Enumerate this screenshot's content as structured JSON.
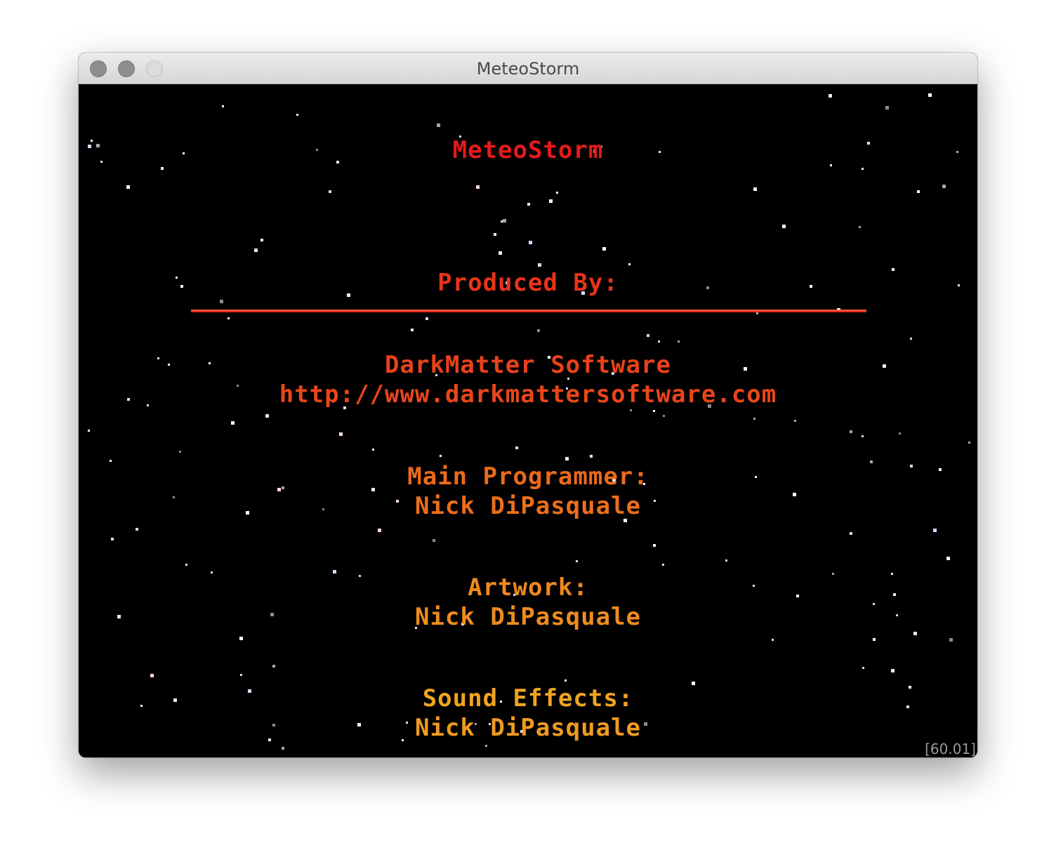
{
  "window": {
    "title": "MeteoStorm"
  },
  "credits": {
    "game_title": "MeteoStorm",
    "produced_by_label": "Produced By:",
    "producer_name": "DarkMatter Software",
    "producer_url": "http://www.darkmattersoftware.com",
    "main_programmer_label": "Main Programmer:",
    "main_programmer_name": "Nick DiPasquale",
    "artwork_label": "Artwork:",
    "artwork_name": "Nick DiPasquale",
    "sound_effects_label": "Sound Effects:",
    "sound_effects_name": "Nick DiPasquale"
  },
  "hud": {
    "fps_readout": "[60.01]"
  },
  "colors": {
    "background": "#000000",
    "title_red": "#e61a1a",
    "divider_red": "#e8231a",
    "text_gradient_top": "#e8321a",
    "text_gradient_bottom": "#f0a020"
  },
  "icons": {
    "close": "window-close-icon",
    "minimize": "window-minimize-icon",
    "zoom": "window-zoom-icon"
  }
}
